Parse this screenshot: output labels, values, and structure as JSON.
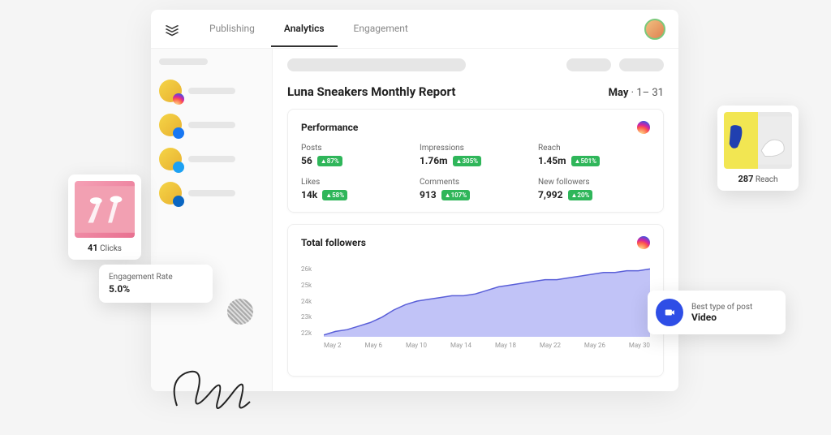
{
  "nav": {
    "tabs": [
      "Publishing",
      "Analytics",
      "Engagement"
    ],
    "active_index": 1
  },
  "sidebar": {
    "accounts": [
      {
        "network": "instagram"
      },
      {
        "network": "facebook"
      },
      {
        "network": "twitter"
      },
      {
        "network": "linkedin"
      }
    ]
  },
  "report": {
    "title": "Luna Sneakers Monthly Report",
    "month": "May",
    "range_dot": "·",
    "range": "1– 31"
  },
  "performance": {
    "heading": "Performance",
    "metrics": [
      {
        "label": "Posts",
        "value": "56",
        "delta": "▲87%"
      },
      {
        "label": "Impressions",
        "value": "1.76m",
        "delta": "▲305%"
      },
      {
        "label": "Reach",
        "value": "1.45m",
        "delta": "▲501%"
      },
      {
        "label": "Likes",
        "value": "14k",
        "delta": "▲58%"
      },
      {
        "label": "Comments",
        "value": "913",
        "delta": "▲107%"
      },
      {
        "label": "New followers",
        "value": "7,992",
        "delta": "▲20%"
      }
    ]
  },
  "followers_chart": {
    "heading": "Total followers"
  },
  "chart_data": {
    "type": "area",
    "title": "Total followers",
    "ylabel": "",
    "xlabel": "",
    "ylim": [
      22000,
      26000
    ],
    "y_ticks": [
      "26k",
      "25k",
      "24k",
      "23k",
      "22k"
    ],
    "x_ticks": [
      "May 2",
      "May 6",
      "May 10",
      "May 14",
      "May 18",
      "May 22",
      "May 26",
      "May 30"
    ],
    "x": [
      "May 2",
      "May 3",
      "May 4",
      "May 5",
      "May 6",
      "May 7",
      "May 8",
      "May 9",
      "May 10",
      "May 11",
      "May 12",
      "May 13",
      "May 14",
      "May 15",
      "May 16",
      "May 17",
      "May 18",
      "May 19",
      "May 20",
      "May 21",
      "May 22",
      "May 23",
      "May 24",
      "May 25",
      "May 26",
      "May 27",
      "May 28",
      "May 29",
      "May 30"
    ],
    "values": [
      22100,
      22300,
      22400,
      22600,
      22800,
      23100,
      23500,
      23800,
      24000,
      24100,
      24200,
      24300,
      24300,
      24400,
      24600,
      24800,
      24900,
      25000,
      25100,
      25200,
      25200,
      25300,
      25400,
      25500,
      25600,
      25600,
      25700,
      25700,
      25800
    ]
  },
  "callouts": {
    "clicks": {
      "value": "41",
      "label": "Clicks"
    },
    "reach": {
      "value": "287",
      "label": "Reach"
    },
    "engagement": {
      "label": "Engagement Rate",
      "value": "5.0%"
    },
    "best_post": {
      "label": "Best type of post",
      "value": "Video"
    }
  }
}
